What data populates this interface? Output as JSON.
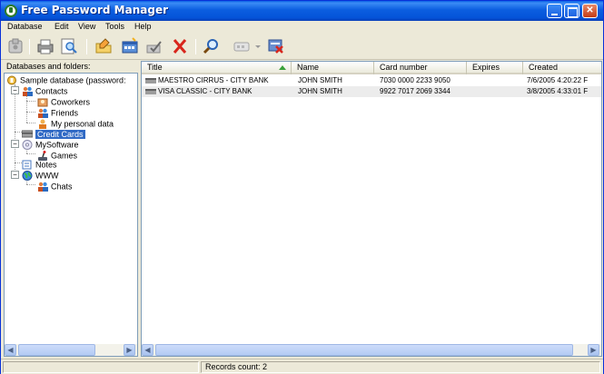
{
  "window": {
    "title": "Free Password Manager"
  },
  "menu": [
    "Database",
    "Edit",
    "View",
    "Tools",
    "Help"
  ],
  "left_panel": {
    "header": "Databases and folders:",
    "tree": [
      {
        "label": "Sample database (password:",
        "icon": "database-icon"
      },
      {
        "label": "Contacts",
        "icon": "people-icon"
      },
      {
        "label": "Coworkers",
        "icon": "people-icon"
      },
      {
        "label": "Friends",
        "icon": "people-icon"
      },
      {
        "label": "My personal data",
        "icon": "person-icon"
      },
      {
        "label": "Credit Cards",
        "icon": "credit-card-icon"
      },
      {
        "label": "MySoftware",
        "icon": "cd-icon"
      },
      {
        "label": "Games",
        "icon": "joystick-icon"
      },
      {
        "label": "Notes",
        "icon": "note-icon"
      },
      {
        "label": "WWW",
        "icon": "globe-icon"
      },
      {
        "label": "Chats",
        "icon": "people-icon"
      }
    ]
  },
  "grid": {
    "columns": [
      "Title",
      "Name",
      "Card number",
      "Expires",
      "Created"
    ],
    "rows": [
      {
        "title": "MAESTRO CIRRUS - CITY BANK",
        "name": "JOHN SMITH",
        "card_number": "7030 0000 2233 9050",
        "expires": "",
        "created": "7/6/2005 4:20:22 F"
      },
      {
        "title": "VISA CLASSIC - CITY BANK",
        "name": "JOHN SMITH",
        "card_number": "9922 7017 2069 3344",
        "expires": "",
        "created": "3/8/2005 4:33:01 F"
      }
    ]
  },
  "status": {
    "records": "Records count: 2"
  },
  "colors": {
    "title_bar": "#0453d8",
    "selection": "#316ac5",
    "accent_green": "#3aa13a"
  }
}
